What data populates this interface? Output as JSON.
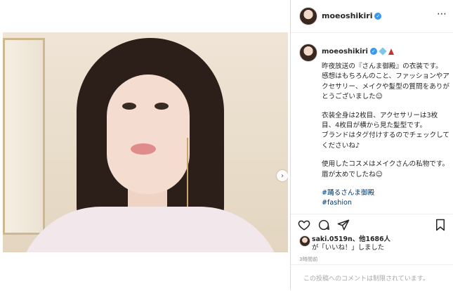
{
  "header": {
    "username": "moeoshikiri",
    "more_icon": "ellipsis-icon"
  },
  "caption": {
    "username": "moeoshikiri",
    "emoji": [
      "gem-icon",
      "dress-icon"
    ],
    "paragraphs": [
      "昨夜放送の『さんま御殿』の衣装です。\n感想はもちろんのこと、ファッションやアクセサリー、メイクや髪型の質問をありがとうございました☺︎",
      "衣装全身は2枚目、アクセサリーは3枚目、4枚目が横から見た髪型です。\nブランドはタグ付けするのでチェックしてくださいね♪",
      "使用したコスメはメイクさんの私物です。\n眉が太めでしたね☺︎"
    ],
    "hashtags": [
      "#踊るさんま御殿",
      "#fashion"
    ]
  },
  "actions": [
    "heart-icon",
    "comment-icon",
    "share-icon",
    "bookmark-icon"
  ],
  "likes": {
    "user": "saki.0519n",
    "others": "、他1686人",
    "suffix": "が「いいね！」しました"
  },
  "time": "3時間前",
  "comment": {
    "placeholder": "この投稿へのコメントは制限されています。"
  },
  "colors": {
    "link": "#00376b",
    "verified": "#3897f0",
    "border": "#dbdbdb",
    "muted": "#8e8e8e"
  }
}
